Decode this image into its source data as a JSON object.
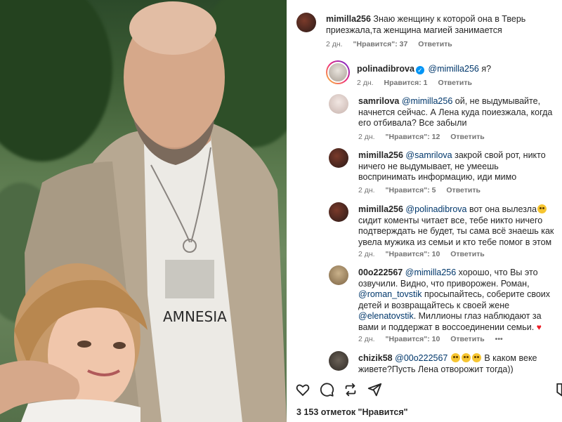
{
  "likes_label": "3 153 отметок \"Нравится\"",
  "photo": {
    "shirt_text": "AMNESIA"
  },
  "comments": [
    {
      "user": "mimilla256",
      "text": "Знаю женщину к которой она в Тверь приезжала,та женщина магией занимается",
      "time": "2 дн.",
      "likes": "\"Нравится\": 37",
      "reply": "Ответить"
    },
    {
      "user": "polinadibrova",
      "mention": "@mimilla256",
      "text": "я?",
      "time": "2 дн.",
      "likes": "Нравится: 1",
      "reply": "Ответить"
    },
    {
      "user": "samrilova",
      "mention": "@mimilla256",
      "text": "ой, не выдумывайте, начнется сейчас. А Лена куда поиезжала, когда его отбивала? Все забыли",
      "time": "2 дн.",
      "likes": "\"Нравится\": 12",
      "reply": "Ответить"
    },
    {
      "user": "mimilla256",
      "mention": "@samrilova",
      "text": "закрой свой рот, никто ничего не выдумывает, не умеешь воспринимать информацию, иди мимо",
      "time": "2 дн.",
      "likes": "\"Нравится\": 5",
      "reply": "Ответить"
    },
    {
      "user": "mimilla256",
      "mention": "@polinadibrova",
      "text_a": "вот она вылезла",
      "text_b": "сидит коменты читает все, тебе никто ничего подтверждать не будет, ты сама всё знаешь как увела мужика из семьи и кто тебе помог в этом",
      "time": "2 дн.",
      "likes": "\"Нравится\": 10",
      "reply": "Ответить"
    },
    {
      "user": "00o222567",
      "mention": "@mimilla256",
      "text_a": "хорошо, что Вы это озвучили. Видно, что приворожен. Роман,",
      "mention_b": "@roman_tovstik",
      "text_b": "просыпайтесь, соберите своих детей и возвращайтесь к своей жене",
      "mention_c": "@elenatovstik",
      "text_c": ". Миллионы глаз наблюдают за вами и поддержат в воссоединении семьи.",
      "time": "2 дн.",
      "likes": "\"Нравится\": 10",
      "reply": "Ответить",
      "more": "•••"
    },
    {
      "user": "chizik58",
      "mention": "@00o222567",
      "text": "В каком веке живете?Пусть Лена отворожит тогда))"
    }
  ],
  "icons": [
    "heart-outline-icon",
    "comment-icon",
    "share-icon",
    "bookmark-icon"
  ]
}
